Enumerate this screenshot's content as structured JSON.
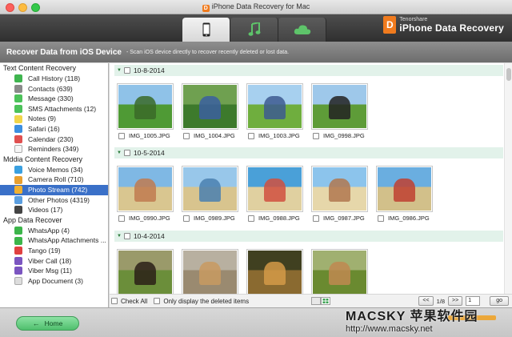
{
  "window": {
    "title": "iPhone Data Recovery for Mac",
    "logo_letter": "D"
  },
  "toolbar": {
    "mode_icons": [
      "phone-icon",
      "music-note-icon",
      "cloud-icon"
    ],
    "brand_small": "Tenorshare",
    "brand_name": "iPhone Data Recovery",
    "brand_logo_letter": "D"
  },
  "infobar": {
    "title": "Recover Data from iOS Device",
    "description": "- Scan iOS device directly to recover recently deleted or lost data."
  },
  "sidebar": {
    "sections": [
      {
        "header": "Text Content Recovery",
        "items": [
          {
            "label": "Call History (118)",
            "icon": "phone-icon",
            "color": "#3fb54f"
          },
          {
            "label": "Contacts (639)",
            "icon": "contacts-icon",
            "color": "#8a8a8a"
          },
          {
            "label": "Message (330)",
            "icon": "message-icon",
            "color": "#4cc25a"
          },
          {
            "label": "SMS Attachments (12)",
            "icon": "sms-attachment-icon",
            "color": "#4cc25a"
          },
          {
            "label": "Notes (9)",
            "icon": "notes-icon",
            "color": "#f1d54a"
          },
          {
            "label": "Safari (16)",
            "icon": "safari-icon",
            "color": "#3c8fe0"
          },
          {
            "label": "Calendar (230)",
            "icon": "calendar-icon",
            "color": "#e05050"
          },
          {
            "label": "Reminders (349)",
            "icon": "reminders-icon",
            "color": "#f5f5f5"
          }
        ]
      },
      {
        "header": "Mddia Content Recovery",
        "items": [
          {
            "label": "Voice Memos (34)",
            "icon": "voice-memo-icon",
            "color": "#3aa0e0"
          },
          {
            "label": "Camera Roll (710)",
            "icon": "camera-roll-icon",
            "color": "#e8a030"
          },
          {
            "label": "Photo Stream (742)",
            "icon": "photo-stream-icon",
            "color": "#f0b030",
            "selected": true
          },
          {
            "label": "Other Photos (4319)",
            "icon": "other-photos-icon",
            "color": "#5a9ee0"
          },
          {
            "label": "Videos (17)",
            "icon": "videos-icon",
            "color": "#444444"
          }
        ]
      },
      {
        "header": "App Data Recover",
        "items": [
          {
            "label": "WhatsApp (4)",
            "icon": "whatsapp-icon",
            "color": "#3cb54a"
          },
          {
            "label": "WhatsApp Attachments ...",
            "icon": "whatsapp-attachment-icon",
            "color": "#3cb54a"
          },
          {
            "label": "Tango (19)",
            "icon": "tango-icon",
            "color": "#e04040"
          },
          {
            "label": "Viber Call (18)",
            "icon": "viber-call-icon",
            "color": "#7b55c0"
          },
          {
            "label": "Viber Msg (11)",
            "icon": "viber-msg-icon",
            "color": "#7b55c0"
          },
          {
            "label": "App Document (3)",
            "icon": "app-document-icon",
            "color": "#dddddd"
          }
        ]
      }
    ]
  },
  "groups": [
    {
      "date": "10-8-2014",
      "photos": [
        {
          "name": "IMG_1005.JPG",
          "sky": "#8fc2e8",
          "ground": "#4f9a35",
          "subject": "#3a6a28"
        },
        {
          "name": "IMG_1004.JPG",
          "sky": "#6fa050",
          "ground": "#3d7a2c",
          "subject": "#3b5fa0"
        },
        {
          "name": "IMG_1003.JPG",
          "sky": "#a7d0ef",
          "ground": "#6fae3e",
          "subject": "#3d5a90"
        },
        {
          "name": "IMG_0998.JPG",
          "sky": "#9ec8ea",
          "ground": "#5e9c38",
          "subject": "#222222"
        }
      ]
    },
    {
      "date": "10-5-2014",
      "photos": [
        {
          "name": "IMG_0990.JPG",
          "sky": "#7fb8e4",
          "ground": "#d9c690",
          "subject": "#c07a50"
        },
        {
          "name": "IMG_0989.JPG",
          "sky": "#98c7ea",
          "ground": "#d8c48e",
          "subject": "#4a80b0"
        },
        {
          "name": "IMG_0988.JPG",
          "sky": "#4aa0d8",
          "ground": "#e0d0a0",
          "subject": "#d05040"
        },
        {
          "name": "IMG_0987.JPG",
          "sky": "#8cc4ec",
          "ground": "#e6d7aa",
          "subject": "#b07850"
        },
        {
          "name": "IMG_0986.JPG",
          "sky": "#6aaee0",
          "ground": "#d2c08a",
          "subject": "#c04030"
        }
      ]
    },
    {
      "date": "10-4-2014",
      "photos": [
        {
          "name": "",
          "sky": "#9a9a6a",
          "ground": "#6b8e3a",
          "subject": "#2a2018"
        },
        {
          "name": "",
          "sky": "#b8b0a0",
          "ground": "#9a8a70",
          "subject": "#c89a60"
        },
        {
          "name": "",
          "sky": "#404020",
          "ground": "#8a6a30",
          "subject": "#d49a48"
        },
        {
          "name": "",
          "sky": "#a0b070",
          "ground": "#6a8a30",
          "subject": "#c08850"
        }
      ]
    }
  ],
  "bottombar": {
    "check_all_label": "Check All",
    "only_deleted_label": "Only display the deleted items",
    "prev_label": "<<",
    "page_indicator": "1/8",
    "next_label": ">>",
    "page_input_value": "1",
    "go_label": "go"
  },
  "footer": {
    "home_label": "Home"
  },
  "watermark": {
    "line1": "MACSKY 苹果软件园",
    "line2": "http://www.macsky.net"
  }
}
